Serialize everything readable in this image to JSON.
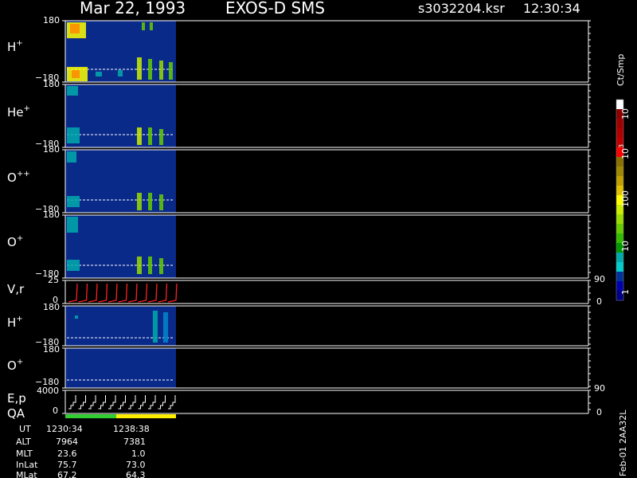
{
  "header": {
    "date": "Mar 22, 1993",
    "instrument": "EXOS-D SMS",
    "file": "s3032204.ksr",
    "time": "12:30:34"
  },
  "colors": {
    "spectrogram_bg": "#0a2a8a",
    "axis": "#ffffff",
    "vr_trace": "#ff2020",
    "qa_good": "#33cc33",
    "qa_warn": "#ffee00"
  },
  "panels": [
    {
      "label": "H",
      "sup": "+",
      "top_tick": "180",
      "bottom_tick": "−180"
    },
    {
      "label": "He",
      "sup": "+",
      "top_tick": "180",
      "bottom_tick": "−180"
    },
    {
      "label": "O",
      "sup": "++",
      "top_tick": "180",
      "bottom_tick": "−180"
    },
    {
      "label": "O",
      "sup": "+",
      "top_tick": "180",
      "bottom_tick": "−180"
    },
    {
      "label": "V,r",
      "sup": "",
      "top_tick": "25",
      "bottom_tick": "0",
      "right_top": "90",
      "right_bottom": "0"
    },
    {
      "label": "H",
      "sup": "+",
      "top_tick": "180",
      "bottom_tick": "−180"
    },
    {
      "label": "O",
      "sup": "+",
      "top_tick": "180",
      "bottom_tick": "−180"
    },
    {
      "label": "E,p",
      "label2": "QA",
      "sup": "",
      "top_tick": "4000",
      "bottom_tick": "0",
      "right_top": "90",
      "right_bottom": "0"
    }
  ],
  "colorbar": {
    "title": "Ct/Smp",
    "labels": [
      {
        "base": "10",
        "exp": "4"
      },
      {
        "base": "10",
        "exp": "3"
      },
      {
        "base": "100",
        "exp": ""
      },
      {
        "base": "10",
        "exp": ""
      },
      {
        "base": "1",
        "exp": ""
      }
    ],
    "colors": [
      "#ffffff",
      "#8b0000",
      "#a00000",
      "#b00000",
      "#c00000",
      "#ff0000",
      "#8a7000",
      "#a08800",
      "#c0a000",
      "#e0c000",
      "#ffff00",
      "#ccee00",
      "#99dd00",
      "#66cc00",
      "#33bb00",
      "#009900",
      "#00aaaa",
      "#00cccc",
      "#003399",
      "#0000aa",
      "#000080"
    ]
  },
  "footer": {
    "rows": [
      {
        "name": "UT",
        "v1": "1230:34",
        "v2": "1238:38"
      },
      {
        "name": "ALT",
        "v1": "7964",
        "v2": "7381"
      },
      {
        "name": "MLT",
        "v1": "23.6",
        "v2": "1.0"
      },
      {
        "name": "InLat",
        "v1": "75.7",
        "v2": "73.0"
      },
      {
        "name": "MLat",
        "v1": "67.2",
        "v2": "64.3"
      }
    ],
    "stamp": "Feb-01 2AA32L"
  },
  "chart_data": {
    "type": "heatmap",
    "title": "Mar 22, 1993 EXOS-D SMS",
    "panels": [
      "H+",
      "He+",
      "O++",
      "O+",
      "V,r",
      "H+",
      "O+",
      "E,p QA"
    ],
    "pitch_angle_range": [
      -180,
      180
    ],
    "vr_range": [
      0,
      25
    ],
    "ep_range": [
      0,
      4000
    ],
    "colorbar_unit": "Ct/Smp",
    "colorbar_range": [
      1,
      10000
    ],
    "time_labels": [
      "1230:34",
      "1238:38"
    ]
  }
}
